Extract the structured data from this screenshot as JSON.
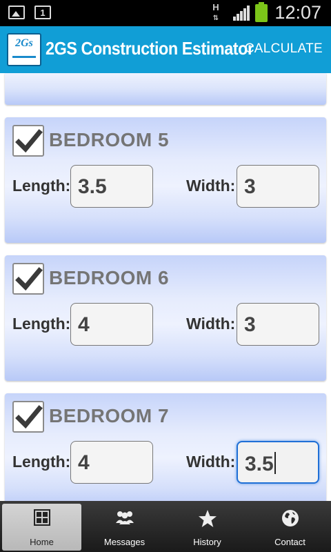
{
  "status_bar": {
    "time": "12:07",
    "network_type": "H",
    "notification_badge": "1",
    "battery_color": "#7cc519"
  },
  "app_bar": {
    "logo_text": "2Gs",
    "title": "2GS Construction Estimator",
    "action_label": "CALCULATE",
    "color": "#119ed6"
  },
  "rooms": [
    {
      "name": "BEDROOM 5",
      "checked": true,
      "length_label": "Length:",
      "length": "3.5",
      "width_label": "Width:",
      "width": "3"
    },
    {
      "name": "BEDROOM 6",
      "checked": true,
      "length_label": "Length:",
      "length": "4",
      "width_label": "Width:",
      "width": "3"
    },
    {
      "name": "BEDROOM 7",
      "checked": true,
      "length_label": "Length:",
      "length": "4",
      "width_label": "Width:",
      "width": "3.5"
    }
  ],
  "bottom_nav": {
    "items": [
      {
        "label": "Home",
        "icon": "grid-icon",
        "active": true
      },
      {
        "label": "Messages",
        "icon": "people-icon",
        "active": false
      },
      {
        "label": "History",
        "icon": "star-icon",
        "active": false
      },
      {
        "label": "Contact",
        "icon": "globe-icon",
        "active": false
      }
    ]
  }
}
